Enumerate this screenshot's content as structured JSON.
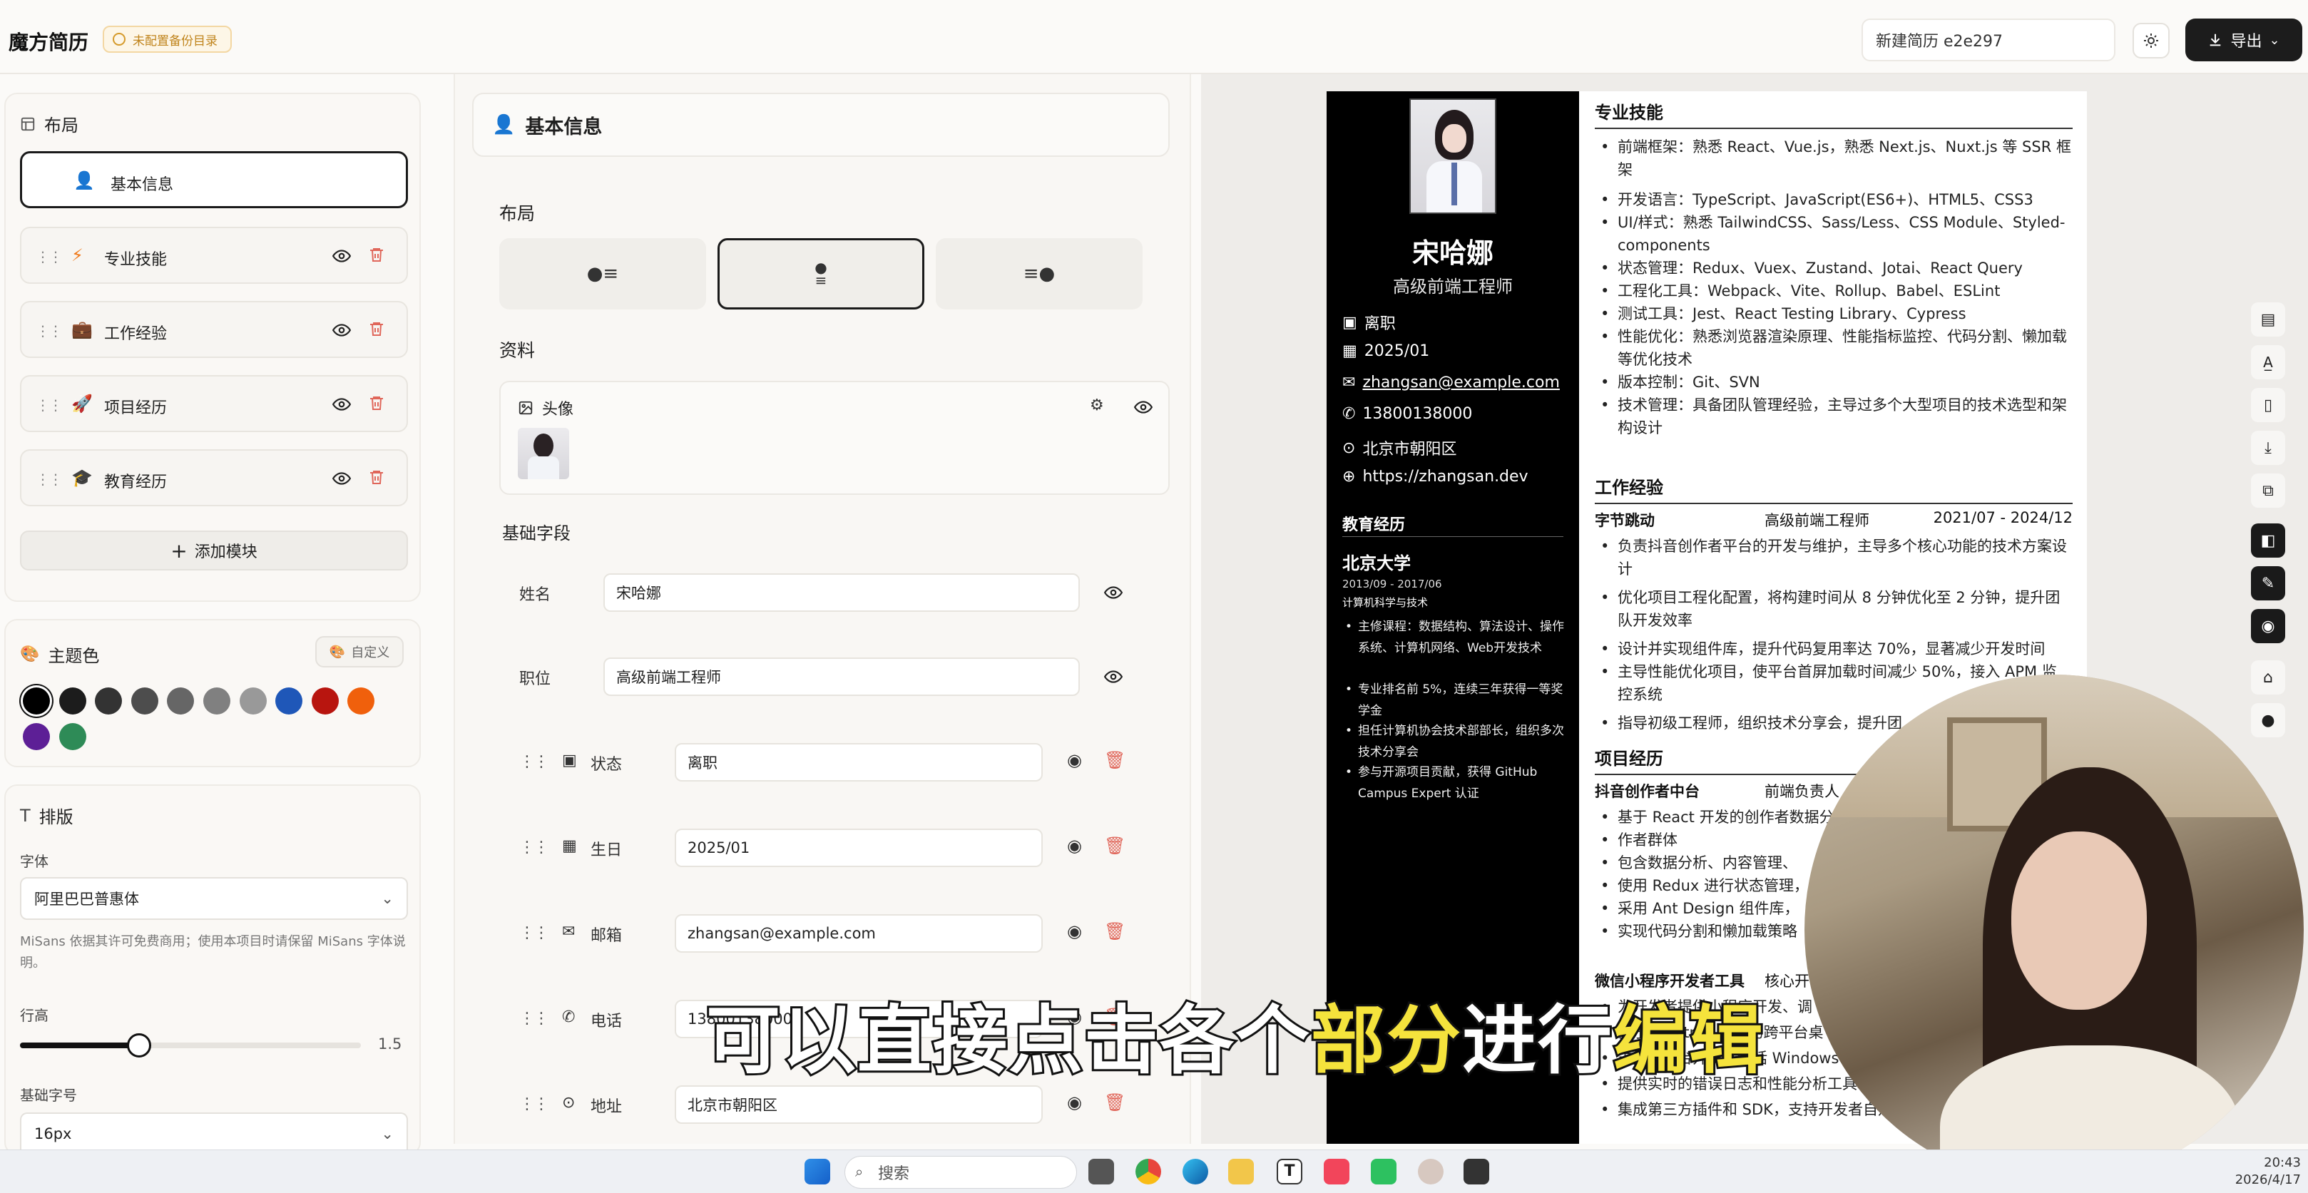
{
  "header": {
    "app_title": "魔方简历",
    "backup_badge": "未配置备份目录",
    "resume_name": "新建简历 e2e297",
    "export_label": "导出"
  },
  "layout_panel": {
    "title": "布局",
    "modules": [
      {
        "label": "基本信息",
        "icon": "user-icon",
        "active": true
      },
      {
        "label": "专业技能",
        "icon": "lightning-icon"
      },
      {
        "label": "工作经验",
        "icon": "briefcase-icon"
      },
      {
        "label": "项目经历",
        "icon": "rocket-icon"
      },
      {
        "label": "教育经历",
        "icon": "graduation-cap-icon"
      }
    ],
    "add_module": "添加模块"
  },
  "theme_panel": {
    "title": "主题色",
    "custom_label": "自定义",
    "colors": [
      "#000000",
      "#1c1c1c",
      "#333333",
      "#4d4d4d",
      "#666666",
      "#808080",
      "#999999",
      "#1f57b8",
      "#b8150f",
      "#f0600c",
      "#5d1f96",
      "#2e8b57"
    ]
  },
  "type_panel": {
    "title": "排版",
    "font_label": "字体",
    "font_value": "阿里巴巴普惠体",
    "font_note": "MiSans 依据其许可免费商用；使用本项目时请保留 MiSans 字体说明。",
    "line_height_label": "行高",
    "line_height_value": "1.5",
    "line_height_level": 0.35,
    "base_size_label": "基础字号",
    "base_size_value": "16px"
  },
  "editor": {
    "title": "基本信息",
    "layout_label": "布局",
    "layout_options": [
      "●≡",
      "●\n≡",
      "≡●"
    ],
    "profile_label": "资料",
    "avatar_label": "头像",
    "base_fields_label": "基础字段",
    "name_label": "姓名",
    "name_value": "宋哈娜",
    "job_label": "职位",
    "job_value": "高级前端工程师",
    "fields": [
      {
        "label": "状态",
        "value": "离职",
        "icon": "briefcase-icon"
      },
      {
        "label": "生日",
        "value": "2025/01",
        "icon": "calendar-icon"
      },
      {
        "label": "邮箱",
        "value": "zhangsan@example.com",
        "icon": "mail-icon"
      },
      {
        "label": "电话",
        "value": "13800138000",
        "icon": "phone-icon"
      },
      {
        "label": "地址",
        "value": "北京市朝阳区",
        "icon": "location-icon"
      }
    ]
  },
  "resume": {
    "name": "宋哈娜",
    "job": "高级前端工程师",
    "info": [
      "离职",
      "2025/01",
      "zhangsan@example.com",
      "13800138000",
      "北京市朝阳区",
      "https://zhangsan.dev"
    ],
    "edu_title": "教育经历",
    "school": "北京大学",
    "edu_dates": "2013/09 - 2017/06",
    "major": "计算机科学与技术",
    "edu_bullets": [
      "主修课程：数据结构、算法设计、操作系统、计算机网络、Web开发技术",
      "专业排名前 5%，连续三年获得一等奖学金",
      "担任计算机协会技术部部长，组织多次技术分享会",
      "参与开源项目贡献，获得 GitHub Campus Expert 认证"
    ],
    "skills_title": "专业技能",
    "skills": [
      "前端框架：熟悉 React、Vue.js，熟悉 Next.js、Nuxt.js 等 SSR 框架",
      "开发语言：TypeScript、JavaScript(ES6+)、HTML5、CSS3",
      "UI/样式：熟悉 TailwindCSS、Sass/Less、CSS Module、Styled-components",
      "状态管理：Redux、Vuex、Zustand、Jotai、React Query",
      "工程化工具：Webpack、Vite、Rollup、Babel、ESLint",
      "测试工具：Jest、React Testing Library、Cypress",
      "性能优化：熟悉浏览器渲染原理、性能指标监控、代码分割、懒加载等优化技术",
      "版本控制：Git、SVN",
      "技术管理：具备团队管理经验，主导过多个大型项目的技术选型和架构设计"
    ],
    "work_title": "工作经验",
    "work_company": "字节跳动",
    "work_role": "高级前端工程师",
    "work_dates": "2021/07 - 2024/12",
    "work_bullets": [
      "负责抖音创作者平台的开发与维护，主导多个核心功能的技术方案设计",
      "优化项目工程化配置，将构建时间从 8 分钟优化至 2 分钟，提升团队开发效率",
      "设计并实现组件库，提升代码复用率达 70%，显著减少开发时间",
      "主导性能优化项目，使平台首屏加载时间减少 50%，接入 APM 监控系统",
      "指导初级工程师，组织技术分享会，提升团"
    ],
    "proj_title": "项目经历",
    "proj1_name": "抖音创作者中台",
    "proj1_role": "前端负责人",
    "proj1_bullets": [
      "基于 React 开发的创作者数据分",
      "作者群体",
      "包含数据分析、内容管理、",
      "使用 Redux 进行状态管理，",
      "采用 Ant Design 组件库，",
      "实现代码分割和懒加载策略"
    ],
    "proj2_name": "微信小程序开发者工具",
    "proj2_role": "核心开",
    "proj2_bullets": [
      "为开发者提供小程序开发、调",
      "基于 Electron 构建的跨平台桌",
      "支持多平台开发，包括 Windows",
      "提供实时的错误日志和性能分析工具",
      "集成第三方插件和 SDK，支持开发者自定"
    ]
  },
  "subtitle": {
    "part1": "可以直接点击各个",
    "part2": "部分",
    "part3": "进行",
    "part4": "编辑"
  },
  "taskbar": {
    "search": "搜索",
    "time": "20:43",
    "date": "2026/4/17"
  }
}
